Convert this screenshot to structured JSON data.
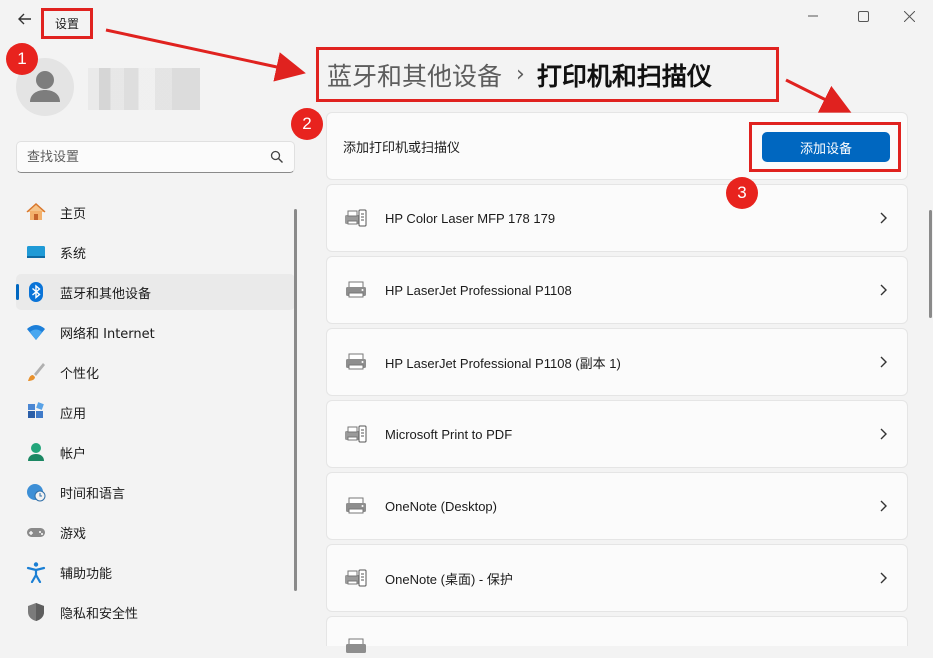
{
  "window": {
    "title": "设置"
  },
  "search": {
    "placeholder": "查找设置"
  },
  "sidebar": {
    "items": [
      {
        "label": "主页",
        "icon": "home-icon"
      },
      {
        "label": "系统",
        "icon": "system-icon"
      },
      {
        "label": "蓝牙和其他设备",
        "icon": "bluetooth-icon",
        "active": true
      },
      {
        "label": "网络和 Internet",
        "icon": "wifi-icon"
      },
      {
        "label": "个性化",
        "icon": "brush-icon"
      },
      {
        "label": "应用",
        "icon": "apps-icon"
      },
      {
        "label": "帐户",
        "icon": "account-icon"
      },
      {
        "label": "时间和语言",
        "icon": "clock-globe-icon"
      },
      {
        "label": "游戏",
        "icon": "gamepad-icon"
      },
      {
        "label": "辅助功能",
        "icon": "accessibility-icon"
      },
      {
        "label": "隐私和安全性",
        "icon": "shield-icon"
      }
    ]
  },
  "breadcrumb": {
    "parent": "蓝牙和其他设备",
    "separator": "›",
    "current": "打印机和扫描仪"
  },
  "add_section": {
    "label": "添加打印机或扫描仪",
    "button_label": "添加设备"
  },
  "devices": [
    {
      "name": "HP Color Laser MFP 178 179"
    },
    {
      "name": "HP LaserJet Professional P1108"
    },
    {
      "name": "HP LaserJet Professional P1108 (副本 1)"
    },
    {
      "name": "Microsoft Print to PDF"
    },
    {
      "name": "OneNote (Desktop)"
    },
    {
      "name": "OneNote (桌面) - 保护"
    }
  ],
  "markers": [
    "1",
    "2",
    "3"
  ],
  "colors": {
    "accent": "#0067c0",
    "annotation_red": "#e0221f"
  }
}
